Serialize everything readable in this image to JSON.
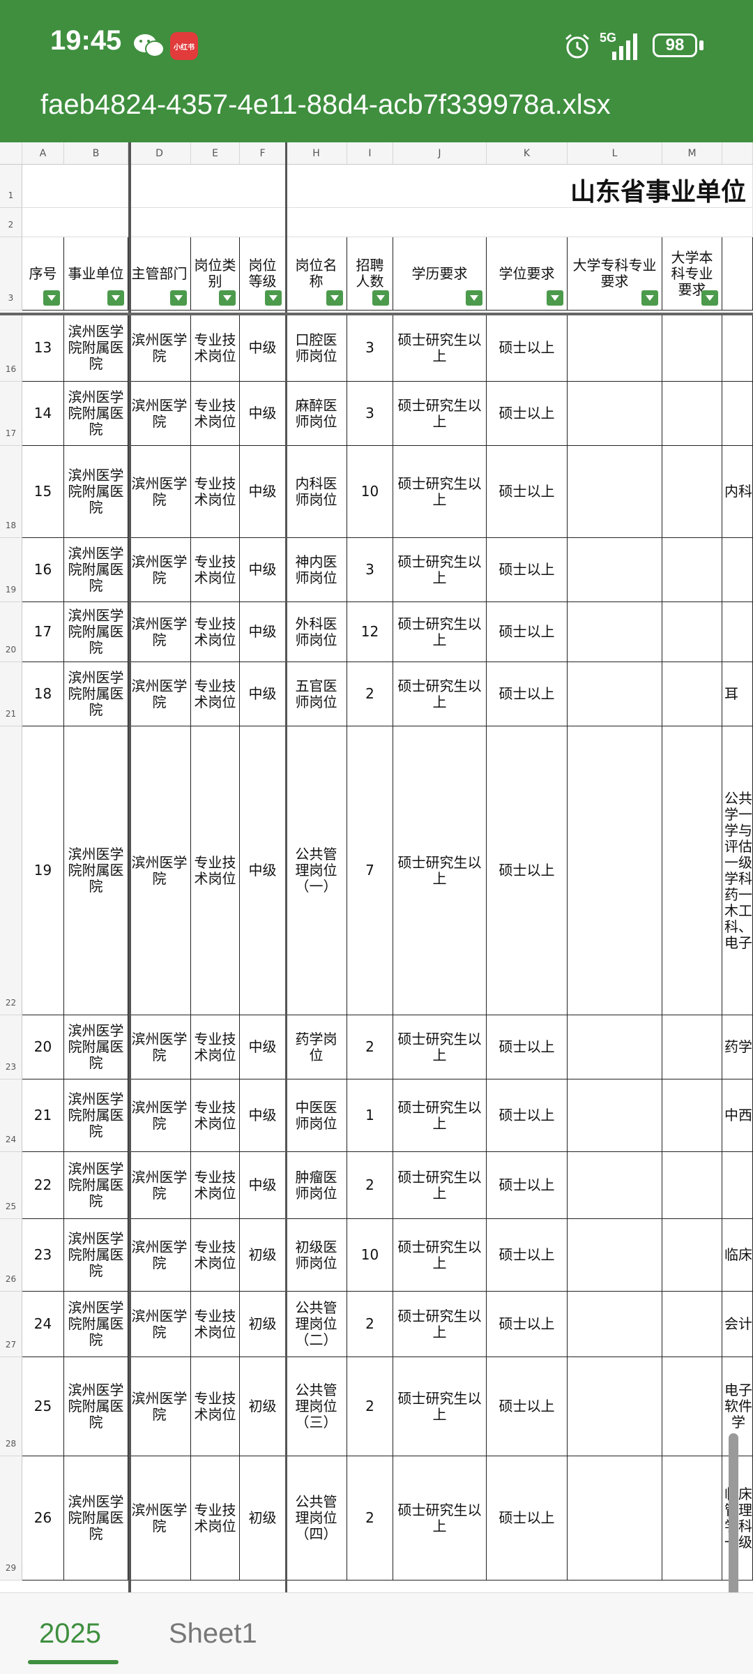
{
  "status_bar": {
    "time": "19:45",
    "redbook_label": "小红书",
    "network": "5G",
    "battery": "98"
  },
  "file": {
    "name": "faeb4824-4357-4e11-88d4-acb7f339978a.xlsx"
  },
  "sheet": {
    "title_partial": "山东省事业单位",
    "column_letters": [
      "A",
      "B",
      "D",
      "E",
      "F",
      "H",
      "I",
      "J",
      "K",
      "L",
      "M"
    ],
    "headers": [
      "序号",
      "事业单位",
      "主管部门",
      "岗位类别",
      "岗位等级",
      "岗位名称",
      "招聘人数",
      "学历要求",
      "学位要求",
      "大学专科专业要求",
      "大学本科专业要求"
    ],
    "rows": [
      {
        "row": "16",
        "no": "13",
        "unit": "滨州医学院附属医院",
        "dept": "滨州医学院",
        "cat": "专业技术岗位",
        "level": "中级",
        "pos": "口腔医师岗位",
        "n": "3",
        "edu": "硕士研究生以上",
        "deg": "硕士以上",
        "extra": ""
      },
      {
        "row": "17",
        "no": "14",
        "unit": "滨州医学院附属医院",
        "dept": "滨州医学院",
        "cat": "专业技术岗位",
        "level": "中级",
        "pos": "麻醉医师岗位",
        "n": "3",
        "edu": "硕士研究生以上",
        "deg": "硕士以上",
        "extra": ""
      },
      {
        "row": "18",
        "no": "15",
        "unit": "滨州医学院附属医院",
        "dept": "滨州医学院",
        "cat": "专业技术岗位",
        "level": "中级",
        "pos": "内科医师岗位",
        "n": "10",
        "edu": "硕士研究生以上",
        "deg": "硕士以上",
        "extra": "内科"
      },
      {
        "row": "19",
        "no": "16",
        "unit": "滨州医学院附属医院",
        "dept": "滨州医学院",
        "cat": "专业技术岗位",
        "level": "中级",
        "pos": "神内医师岗位",
        "n": "3",
        "edu": "硕士研究生以上",
        "deg": "硕士以上",
        "extra": ""
      },
      {
        "row": "20",
        "no": "17",
        "unit": "滨州医学院附属医院",
        "dept": "滨州医学院",
        "cat": "专业技术岗位",
        "level": "中级",
        "pos": "外科医师岗位",
        "n": "12",
        "edu": "硕士研究生以上",
        "deg": "硕士以上",
        "extra": ""
      },
      {
        "row": "21",
        "no": "18",
        "unit": "滨州医学院附属医院",
        "dept": "滨州医学院",
        "cat": "专业技术岗位",
        "level": "中级",
        "pos": "五官医师岗位",
        "n": "2",
        "edu": "硕士研究生以上",
        "deg": "硕士以上",
        "extra": "耳"
      },
      {
        "row": "22",
        "no": "19",
        "unit": "滨州医学院附属医院",
        "dept": "滨州医学院",
        "cat": "专业技术岗位",
        "level": "中级",
        "pos": "公共管理岗位（一）",
        "n": "7",
        "edu": "硕士研究生以上",
        "deg": "硕士以上",
        "extra": "公共学一学与评估一级学科药一木工科、电子"
      },
      {
        "row": "23",
        "no": "20",
        "unit": "滨州医学院附属医院",
        "dept": "滨州医学院",
        "cat": "专业技术岗位",
        "level": "中级",
        "pos": "药学岗位",
        "n": "2",
        "edu": "硕士研究生以上",
        "deg": "硕士以上",
        "extra": "药学"
      },
      {
        "row": "24",
        "no": "21",
        "unit": "滨州医学院附属医院",
        "dept": "滨州医学院",
        "cat": "专业技术岗位",
        "level": "中级",
        "pos": "中医医师岗位",
        "n": "1",
        "edu": "硕士研究生以上",
        "deg": "硕士以上",
        "extra": "中西"
      },
      {
        "row": "25",
        "no": "22",
        "unit": "滨州医学院附属医院",
        "dept": "滨州医学院",
        "cat": "专业技术岗位",
        "level": "中级",
        "pos": "肿瘤医师岗位",
        "n": "2",
        "edu": "硕士研究生以上",
        "deg": "硕士以上",
        "extra": ""
      },
      {
        "row": "26",
        "no": "23",
        "unit": "滨州医学院附属医院",
        "dept": "滨州医学院",
        "cat": "专业技术岗位",
        "level": "初级",
        "pos": "初级医师岗位",
        "n": "10",
        "edu": "硕士研究生以上",
        "deg": "硕士以上",
        "extra": "临床"
      },
      {
        "row": "27",
        "no": "24",
        "unit": "滨州医学院附属医院",
        "dept": "滨州医学院",
        "cat": "专业技术岗位",
        "level": "初级",
        "pos": "公共管理岗位（二）",
        "n": "2",
        "edu": "硕士研究生以上",
        "deg": "硕士以上",
        "extra": "会计"
      },
      {
        "row": "28",
        "no": "25",
        "unit": "滨州医学院附属医院",
        "dept": "滨州医学院",
        "cat": "专业技术岗位",
        "level": "初级",
        "pos": "公共管理岗位（三）",
        "n": "2",
        "edu": "硕士研究生以上",
        "deg": "硕士以上",
        "extra": "电子软件学"
      },
      {
        "row": "29",
        "no": "26",
        "unit": "滨州医学院附属医院",
        "dept": "滨州医学院",
        "cat": "专业技术岗位",
        "level": "初级",
        "pos": "公共管理岗位（四）",
        "n": "2",
        "edu": "硕士研究生以上",
        "deg": "硕士以上",
        "extra": "临床管理学科一级"
      }
    ]
  },
  "tabs": [
    "2025",
    "Sheet1"
  ]
}
